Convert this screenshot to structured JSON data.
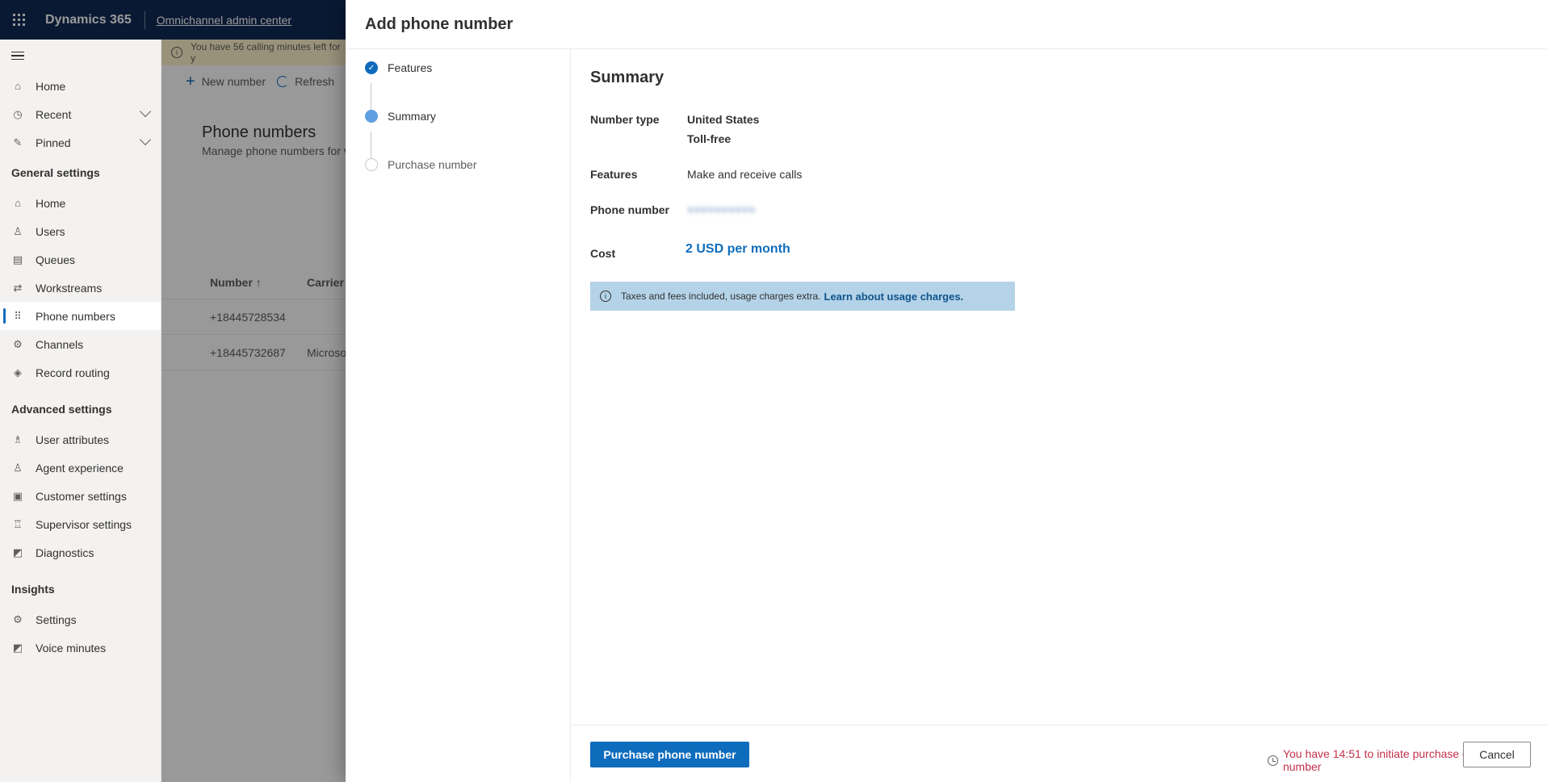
{
  "topbar": {
    "brand": "Dynamics 365",
    "app_name": "Omnichannel admin center"
  },
  "nav": {
    "top_items": [
      {
        "label": "Home",
        "icon": "home-icon"
      },
      {
        "label": "Recent",
        "icon": "clock-icon"
      },
      {
        "label": "Pinned",
        "icon": "pin-icon"
      }
    ],
    "sections": [
      {
        "title": "General settings",
        "items": [
          "Home",
          "Users",
          "Queues",
          "Workstreams",
          "Phone numbers",
          "Channels",
          "Record routing"
        ]
      },
      {
        "title": "Advanced settings",
        "items": [
          "User attributes",
          "Agent experience",
          "Customer settings",
          "Supervisor settings",
          "Diagnostics"
        ]
      },
      {
        "title": "Insights",
        "items": [
          "Settings",
          "Voice minutes"
        ]
      }
    ],
    "active": "Phone numbers"
  },
  "background": {
    "banner": "You have 56 calling minutes left for y",
    "new_number": "New number",
    "refresh": "Refresh",
    "title": "Phone numbers",
    "subtitle": "Manage phone numbers for v",
    "columns": [
      "Number ↑",
      "Carrier"
    ],
    "rows": [
      [
        "+18445728534",
        ""
      ],
      [
        "+18445732687",
        "Microso"
      ]
    ]
  },
  "panel": {
    "title": "Add phone number",
    "steps": [
      {
        "label": "Features",
        "state": "done"
      },
      {
        "label": "Summary",
        "state": "current"
      },
      {
        "label": "Purchase number",
        "state": "todo"
      }
    ],
    "summary": {
      "title": "Summary",
      "number_type_label": "Number type",
      "number_type_country": "United States",
      "number_type_kind": "Toll-free",
      "features_label": "Features",
      "features_value": "Make and receive calls",
      "phone_number_label": "Phone number",
      "cost_label": "Cost",
      "cost_value": "2 USD per month",
      "info_text": "Taxes and fees included, usage charges extra.",
      "info_link": "Learn about usage charges."
    },
    "timer_text": "You have 14:51 to initiate purchase of phone number",
    "purchase_button": "Purchase phone number",
    "cancel_button": "Cancel"
  }
}
